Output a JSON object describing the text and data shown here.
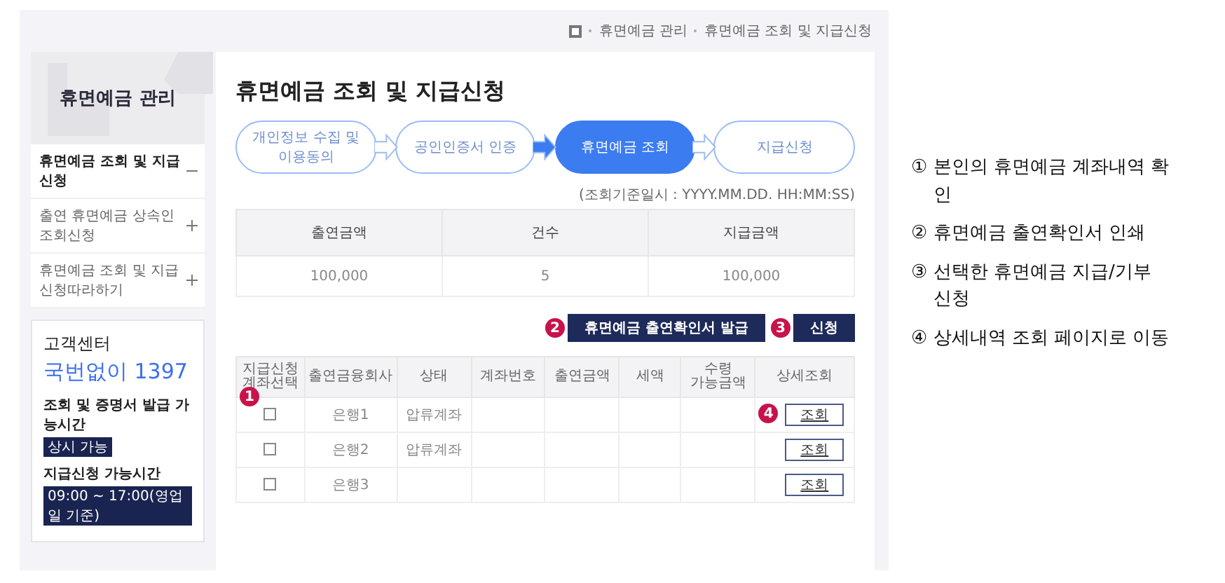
{
  "breadcrumb": [
    "휴면예금 관리",
    "휴면예금 조회 및 지급신청"
  ],
  "sidebar": {
    "title": "휴면예금 관리",
    "items": [
      {
        "label": "휴면예금 조회 및 지급신청",
        "selected": true,
        "expanded": true
      },
      {
        "label": "출연 휴면예금 상속인 조회신청",
        "selected": false,
        "expanded": false
      },
      {
        "label": "휴면예금 조회 및 지급신청따라하기",
        "selected": false,
        "expanded": false
      }
    ]
  },
  "customer_center": {
    "title": "고객센터",
    "phone": "국번없이 1397",
    "hours": [
      {
        "label": "조회 및 증명서 발급 가능시간",
        "value": "상시 가능"
      },
      {
        "label": "지급신청 가능시간",
        "value": "09:00 ~ 17:00(영업일 기준)"
      }
    ]
  },
  "page_title": "휴면예금 조회 및 지급신청",
  "steps": [
    {
      "label": "개인정보 수집 및 이용동의",
      "selected": false
    },
    {
      "label": "공인인증서 인증",
      "selected": false
    },
    {
      "label": "휴면예금 조회",
      "selected": true
    },
    {
      "label": "지급신청",
      "selected": false
    }
  ],
  "timestamp": "(조회기준일시 : YYYY.MM.DD. HH:MM:SS)",
  "summary": {
    "columns": [
      "출연금액",
      "건수",
      "지급금액"
    ],
    "rows": [
      [
        "100,000",
        "5",
        "100,000"
      ]
    ]
  },
  "buttons": [
    {
      "badge": "2",
      "label": "휴면예금 출연확인서 발급"
    },
    {
      "badge": "3",
      "label": "신청"
    }
  ],
  "accounts": {
    "columns": [
      "지급신청\n계좌선택",
      "출연금융회사",
      "상태",
      "계좌번호",
      "출연금액",
      "세액",
      "수령\n가능금액",
      "상세조회"
    ],
    "select_badge": "1",
    "rows": [
      {
        "checked": false,
        "cells": [
          "",
          "은행1",
          "압류계좌",
          "",
          "",
          "",
          "",
          "조회"
        ],
        "action_badge": "4"
      },
      {
        "checked": false,
        "cells": [
          "",
          "은행2",
          "압류계좌",
          "",
          "",
          "",
          "",
          "조회"
        ]
      },
      {
        "checked": false,
        "cells": [
          "",
          "은행3",
          "",
          "",
          "",
          "",
          "",
          "조회"
        ]
      }
    ]
  },
  "notes": [
    "① 본인의 휴면예금 계좌내역 확인",
    "② 휴면예금 출연확인서 인쇄",
    "③ 선택한 휴면예금 지급/기부 신청",
    "④ 상세내역 조회 페이지로 이동"
  ]
}
